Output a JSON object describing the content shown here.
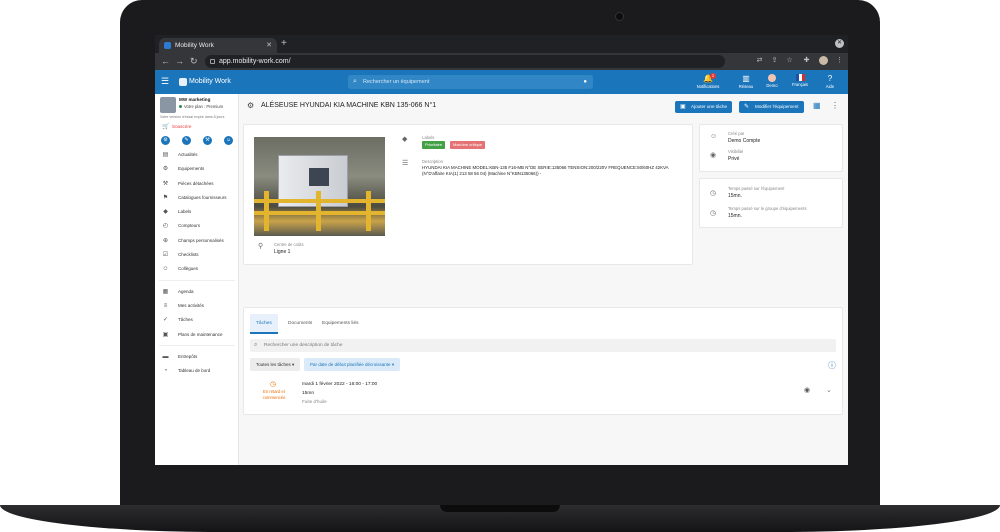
{
  "browser": {
    "tab_title": "Mobility Work",
    "url": "app.mobility-work.com/"
  },
  "header": {
    "brand": "Mobility Work",
    "search_placeholder": "Rechercher un équipement",
    "notifications_label": "Notifications",
    "notifications_count": "2",
    "network_label": "Réseau",
    "home_label": "Demo",
    "language_label": "Français",
    "help_label": "Aide"
  },
  "sidebar": {
    "org_name": "MW marketing",
    "plan": "Votre plan : Premium",
    "trial_note": "Votre version d'essai expire dans 8 jours",
    "upgrade_label": "Souscrire",
    "items": [
      {
        "label": "Actualités",
        "icon": "feed-icon"
      },
      {
        "label": "Equipements",
        "icon": "equipment-icon"
      },
      {
        "label": "Pièces détachées",
        "icon": "parts-icon"
      },
      {
        "label": "Catalogues fournisseurs",
        "icon": "catalog-icon"
      },
      {
        "label": "Labels",
        "icon": "tag-icon"
      },
      {
        "label": "Compteurs",
        "icon": "counter-icon"
      },
      {
        "label": "Champs personnalisés",
        "icon": "custom-fields-icon"
      },
      {
        "label": "Checklists",
        "icon": "checklist-icon"
      },
      {
        "label": "Collègues",
        "icon": "people-icon"
      },
      {
        "label": "Agenda",
        "icon": "calendar-icon"
      },
      {
        "label": "Mes activités",
        "icon": "activity-icon"
      },
      {
        "label": "Tâches",
        "icon": "task-icon"
      },
      {
        "label": "Plans de maintenance",
        "icon": "plan-icon"
      },
      {
        "label": "Entrepôts",
        "icon": "warehouse-icon"
      },
      {
        "label": "Tableau de bord",
        "icon": "dashboard-icon"
      }
    ]
  },
  "page": {
    "title": "ALÉSEUSE HYUNDAI KIA MACHINE KBN 135-066 N°1",
    "add_task_button": "Ajouter une tâche",
    "edit_button": "Modifier l'équipement",
    "labels_title": "Labels",
    "label_1": "Prioritaire",
    "label_2": "Machine critique",
    "description_title": "Description",
    "description": "HYUNDAI KIA MACHINE MODEL:KBN-135 F16-MB N°DE SERIE:135066 TENSION:200/220V FREQUENCE:50/60HZ 42KVA (N°D'affaire KIA(1) 213 58 56 04) (Machine N°KBN135066)) -",
    "cost_center_title": "Centre de coûts",
    "cost_center_value": "Ligne 1",
    "created_by_title": "Créé par",
    "created_by_value": "Demo Compte",
    "visibility_title": "Visibilité",
    "visibility_value": "Privé",
    "time_equipment_title": "Temps passé sur l'équipement",
    "time_equipment_value": "15mn.",
    "time_group_title": "Temps passé sur le groupe d'équipements",
    "time_group_value": "15mn.",
    "colors": {
      "accent": "#1b75bb",
      "label_green": "#43a047",
      "label_red": "#e57373",
      "late": "#ef6c00"
    }
  },
  "tasks": {
    "tabs": [
      "Tâches",
      "Documents",
      "Equipements liés"
    ],
    "search_placeholder": "Rechercher une description de tâche",
    "filter_all": "Toutes les tâches",
    "filter_sort": "Par date de début planifiée décroissante",
    "items": [
      {
        "status": "En retard et commencée",
        "date": "mardi 1 février 2022 - 16:00 - 17:00",
        "duration": "15mn",
        "title": "Fuite d'huile"
      }
    ]
  }
}
